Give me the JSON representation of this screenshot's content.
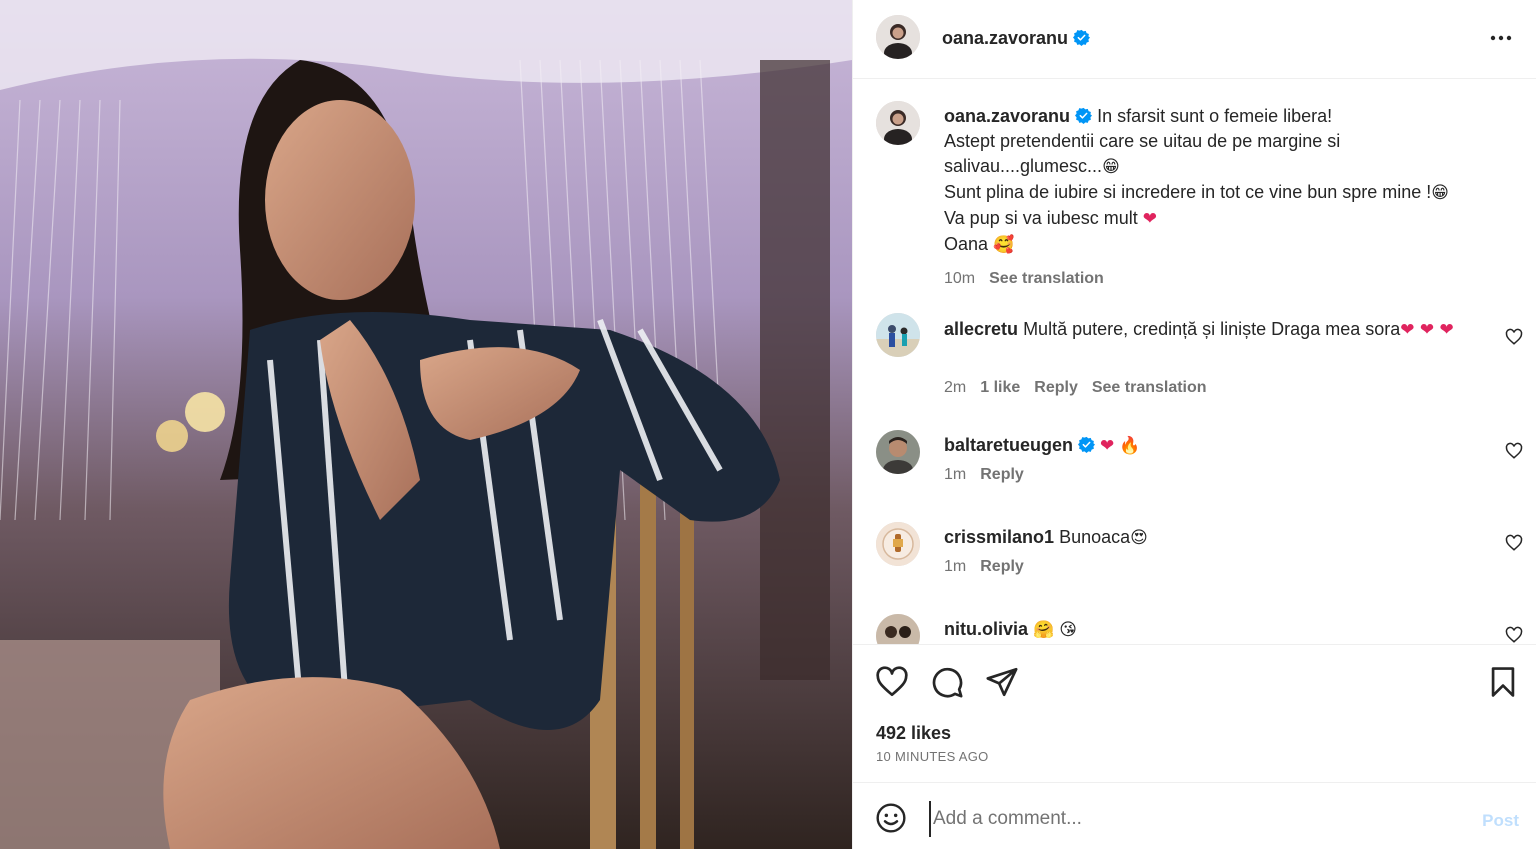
{
  "post": {
    "author": "oana.zavoranu",
    "caption_lines": [
      "In sfarsit sunt o femeie libera!",
      "Astept pretendentii care se uitau de pe margine si",
      "salivau....glumesc...",
      "Sunt plina de iubire si incredere in tot ce vine bun spre mine !",
      "Va pup si va iubesc mult",
      "Oana"
    ],
    "caption_time": "10m",
    "see_translation": "See translation"
  },
  "comments": [
    {
      "user": "allecretu",
      "text": "Multă putere, credință și liniște Draga mea sora",
      "time": "2m",
      "likes": "1 like",
      "reply": "Reply",
      "translate": "See translation",
      "verified": false
    },
    {
      "user": "baltaretueugen",
      "text": "",
      "time": "1m",
      "reply": "Reply",
      "verified": true
    },
    {
      "user": "crissmilano1",
      "text": "Bunoaca",
      "time": "1m",
      "reply": "Reply",
      "verified": false
    },
    {
      "user": "nitu.olivia",
      "text": "",
      "verified": false
    }
  ],
  "footer": {
    "likes": "492 likes",
    "time_ago": "10 MINUTES AGO",
    "comment_placeholder": "Add a comment...",
    "post_label": "Post"
  },
  "colors": {
    "verified": "#0095f6",
    "link": "#0095f6",
    "heart": "#e0245e"
  }
}
